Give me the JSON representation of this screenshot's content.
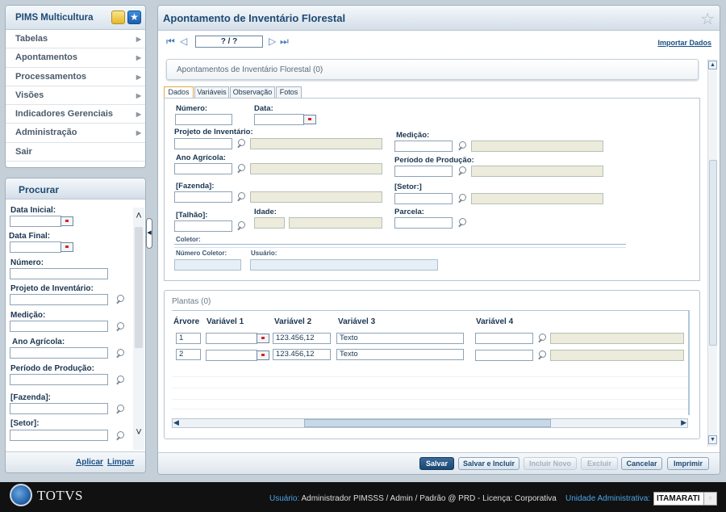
{
  "app": {
    "title": "PIMS Multicultura"
  },
  "menu": [
    {
      "label": "Tabelas"
    },
    {
      "label": "Apontamentos"
    },
    {
      "label": "Processamentos"
    },
    {
      "label": "Visões"
    },
    {
      "label": "Indicadores Gerenciais"
    },
    {
      "label": "Administração"
    },
    {
      "label": "Sair"
    }
  ],
  "search": {
    "title": "Procurar",
    "fields": {
      "data_inicial": "Data Inicial:",
      "data_final": "Data Final:",
      "numero": "Número:",
      "projeto": "Projeto de Inventário:",
      "medicao": "Medição:",
      "ano": "Ano Agrícola:",
      "periodo": "Período de Produção:",
      "fazenda": "[Fazenda]:",
      "setor": "[Setor]:"
    },
    "apply": "Aplicar",
    "clear": "Limpar"
  },
  "main": {
    "title": "Apontamento de Inventário Florestal",
    "record_counter": "? / ?",
    "import_link": "Importar Dados",
    "section_title": "Apontamentos de Inventário Florestal (0)",
    "tabs": [
      "Dados",
      "Variáveis",
      "Observação",
      "Fotos"
    ],
    "form": {
      "numero": "Número:",
      "data": "Data:",
      "projeto": "Projeto de Inventário:",
      "medicao": "Medição:",
      "ano": "Ano Agrícola:",
      "periodo": "Período de Produção:",
      "fazenda": "[Fazenda]:",
      "setor": "[Setor:]",
      "talhao": "[Talhão]:",
      "idade": "Idade:",
      "parcela": "Parcela:",
      "coletor": "Coletor:",
      "numero_coletor": "Número Coletor:",
      "usuario": "Usuário:"
    },
    "plantas": {
      "title": "Plantas (0)",
      "headers": [
        "Árvore",
        "Variável 1",
        "Variável 2",
        "Variável 3",
        "Variável 4"
      ],
      "rows": [
        {
          "arvore": "1",
          "v2": "123.456,12",
          "v3": "Texto"
        },
        {
          "arvore": "2",
          "v2": "123.456,12",
          "v3": "Texto"
        }
      ]
    },
    "buttons": {
      "salvar": "Salvar",
      "salvar_incluir": "Salvar e Incluir",
      "incluir_novo": "Incluir Novo",
      "excluir": "Excluir",
      "cancelar": "Cancelar",
      "imprimir": "Imprimir"
    }
  },
  "footer": {
    "brand": "TOTVS",
    "user_label": "Usuário:",
    "user_value": "Administrador PIMSSS / Admin / Padrão @ PRD - Licença: Corporativa",
    "unit_label": "Unidade Administrativa:",
    "unit_value": "ITAMARATI"
  },
  "colors": {
    "accent": "#1e4a73",
    "primary_button": "#1b4672",
    "footer_bg": "#111111",
    "footer_highlight": "#4aa6e8"
  }
}
